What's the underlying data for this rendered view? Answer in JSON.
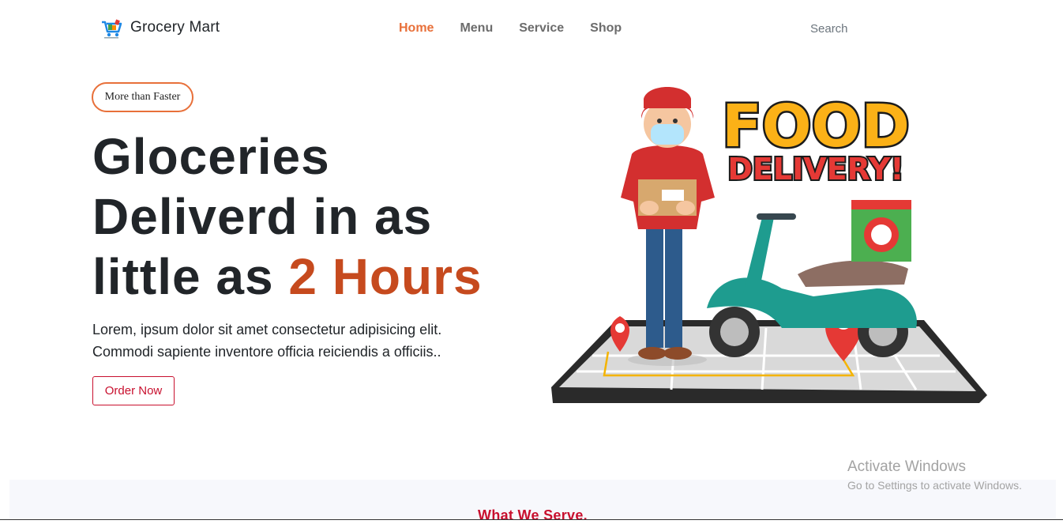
{
  "brand": {
    "name": "Grocery Mart",
    "logo_icon": "cart-icon"
  },
  "nav": {
    "items": [
      "Home",
      "Menu",
      "Service",
      "Shop"
    ],
    "active_color": "#e8703a"
  },
  "search": {
    "placeholder": "Search"
  },
  "hero": {
    "badge": "More than Faster",
    "title_line1": "Gloceries",
    "title_line2": "Deliverd in as",
    "title_line3_pre": "little as",
    "title_line3_accent": "2 Hours",
    "accent_color": "#c64a1e",
    "desc_line1": "Lorem, ipsum dolor sit amet consectetur adipisicing elit.",
    "desc_line2": "Commodi sapiente inventore officia reiciendis a officiis..",
    "cta": "Order Now"
  },
  "illustration": {
    "logo_line1": "FOOD",
    "logo_line2": "DELIVERY!"
  },
  "section": {
    "title": "What We Serve."
  },
  "watermark": {
    "title": "Activate Windows",
    "subtitle": "Go to Settings to activate Windows."
  }
}
